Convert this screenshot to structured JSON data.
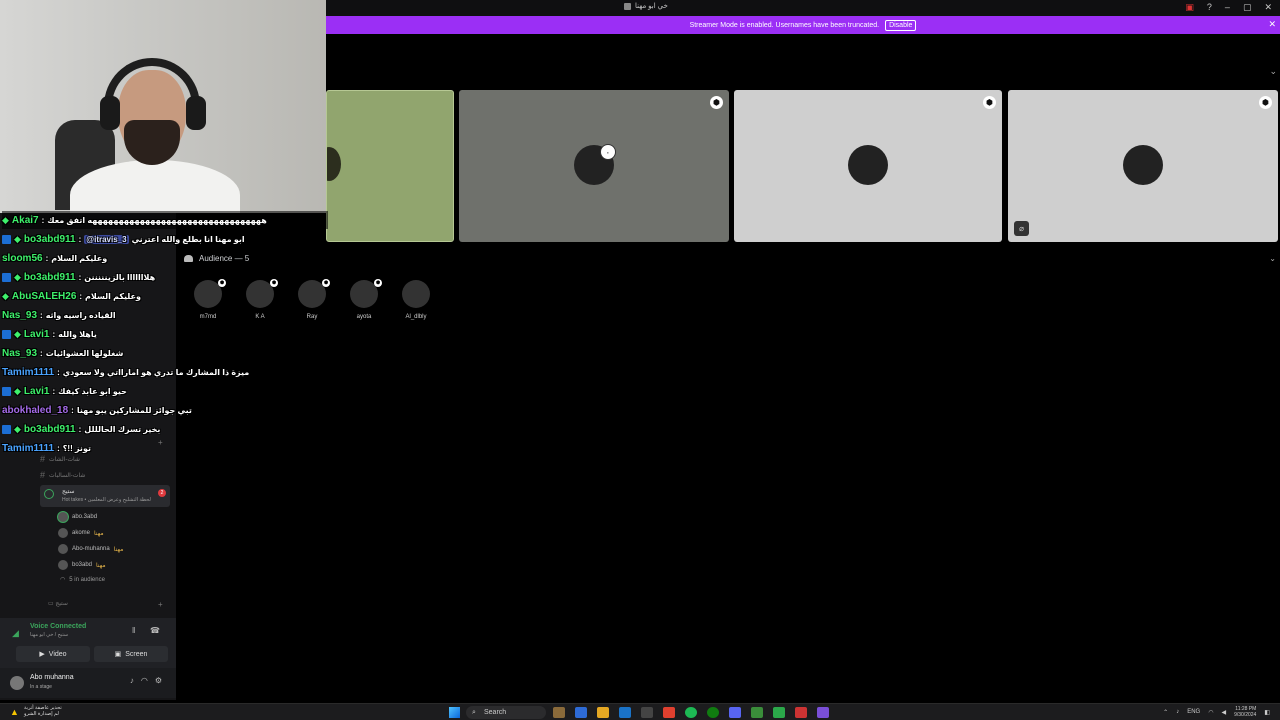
{
  "window": {
    "title": "خي ابو مهنا"
  },
  "banner": {
    "text": "Streamer Mode is enabled. Usernames have been truncated.",
    "disable_label": "Disable"
  },
  "audience": {
    "header": "Audience — 5",
    "members": [
      {
        "name": "m7md",
        "has_mark": true
      },
      {
        "name": "K A",
        "has_mark": true
      },
      {
        "name": "Ray",
        "has_mark": true
      },
      {
        "name": "ayota",
        "has_mark": true
      },
      {
        "name": "Al_dlbly",
        "has_mark": false
      }
    ]
  },
  "chat": [
    {
      "user": "Akai7",
      "user_color": "#3ef06b",
      "badges": [
        "diamond"
      ],
      "text": "هههههههههههههههههههههههههههههههههه اتفق معك"
    },
    {
      "user": "bo3abd911",
      "user_color": "#3ef06b",
      "badges": [
        "square",
        "diamond"
      ],
      "mention": "@itravis_3",
      "text": "ابو مهنا انا بطلع والله اعترني"
    },
    {
      "user": "sloom56",
      "user_color": "#3ef06b",
      "badges": [],
      "text": "وعليكم السلام"
    },
    {
      "user": "bo3abd911",
      "user_color": "#3ef06b",
      "badges": [
        "square",
        "diamond"
      ],
      "text": "هلااااااا بالزينننننن"
    },
    {
      "user": "AbuSALEH26",
      "user_color": "#3ef06b",
      "badges": [
        "diamond"
      ],
      "text": "وعليكم السلام"
    },
    {
      "user": "Nas_93",
      "user_color": "#3ef06b",
      "badges": [],
      "text": "القياده راسيه واثه"
    },
    {
      "user": "Lavi1",
      "user_color": "#3ef06b",
      "badges": [
        "square",
        "diamond"
      ],
      "text": "ياهلا والله"
    },
    {
      "user": "Nas_93",
      "user_color": "#3ef06b",
      "badges": [],
      "text": "شغلولها العشوائيات"
    },
    {
      "user": "Tamim1111",
      "user_color": "#4aa3ff",
      "badges": [],
      "text": "ميزة ذا المشارك ما تدري هو امارااتي ولا سعودي"
    },
    {
      "user": "Lavi1",
      "user_color": "#3ef06b",
      "badges": [
        "square",
        "diamond"
      ],
      "text": "حيو ابو عابد كيفك"
    },
    {
      "user": "abokhaled_18",
      "user_color": "#a46be8",
      "badges": [],
      "text": "تبي جوائز للمشاركين يبو مهنا"
    },
    {
      "user": "bo3abd911",
      "user_color": "#3ef06b",
      "badges": [
        "square",
        "diamond"
      ],
      "text": "بخير تسرك الحالللل"
    },
    {
      "user": "Tamim1111",
      "user_color": "#4aa3ff",
      "badges": [],
      "text": "تونز !!؟"
    }
  ],
  "sidebar": {
    "channels": [
      {
        "label": "شات-الشات",
        "type": "text"
      },
      {
        "label": "شات-السالبات",
        "type": "text"
      }
    ],
    "stage": {
      "name": "ستيج",
      "subtitle": "Hot takes • لحظة التشليح وعرض المعلمين",
      "count": "2"
    },
    "members": [
      {
        "name": "abo.3abd",
        "tag": ""
      },
      {
        "name": "akome",
        "tag": "مهنا"
      },
      {
        "name": "Abo-muhanna",
        "tag": "مهنا"
      },
      {
        "name": "bo3abd",
        "tag": "مهنا"
      }
    ],
    "audience_count": "5 in audience",
    "category": "ستيج"
  },
  "voice": {
    "status": "Voice Connected",
    "channel": "ستيج / خي ابو مهنا",
    "video_label": "Video",
    "screen_label": "Screen"
  },
  "user": {
    "name": "Abo muhanna",
    "status": "In a stage"
  },
  "taskbar": {
    "warning_line1": "تحذير عاصفة أتربة",
    "warning_line2": "لم إصدارة الشرو",
    "search_label": "Search",
    "lang": "ENG",
    "time": "11:28 PM",
    "date": "9/30/2024"
  }
}
